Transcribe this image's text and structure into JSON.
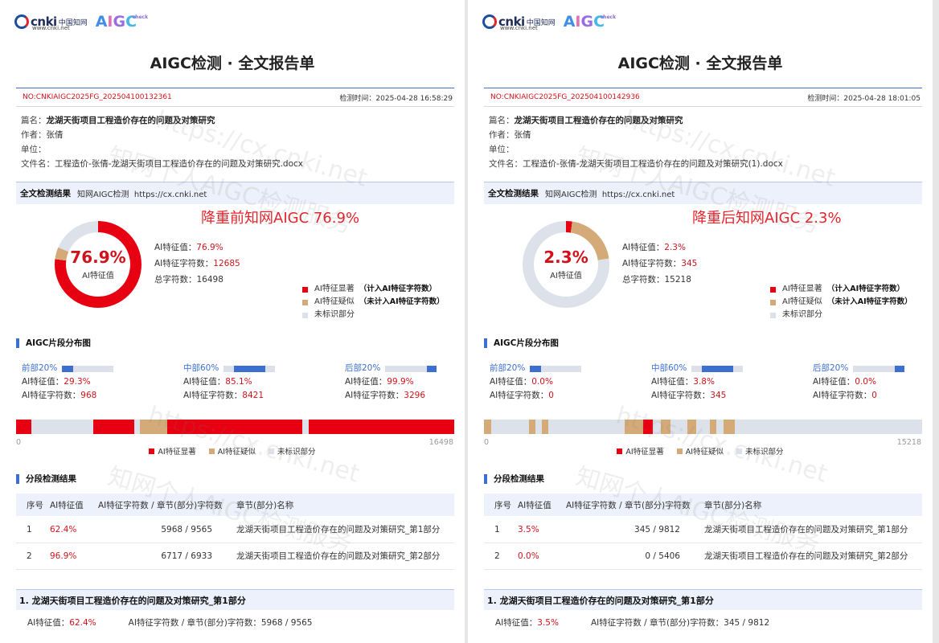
{
  "brand": {
    "cnki": "cnki",
    "cnki_cn": "中国知网",
    "cnki_url": "www.cnki.net",
    "aigc_letters": [
      "A",
      "I",
      "G",
      "C"
    ],
    "aigc_check": "check"
  },
  "report_title": "AIGC检测 · 全文报告单",
  "labels": {
    "detect_time": "检测时间：",
    "paper": "篇名：",
    "author": "作者：",
    "unit": "单位：",
    "filename": "文件名：",
    "fulltext_result": "全文检测结果",
    "service_name": "知网AIGC检测",
    "service_url": "https://cx.cnki.net",
    "ai_value": "AI特征值：",
    "ai_chars": "AI特征字符数：",
    "total_chars": "总字符数：",
    "donut_caption": "AI特征值",
    "legend": [
      {
        "name": "AI特征显著",
        "note": "（计入AI特征字符数）",
        "color": "#e60012"
      },
      {
        "name": "AI特征疑似",
        "note": "（未计入AI特征字符数）",
        "color": "#d4aa79"
      },
      {
        "name": "未标识部分",
        "note": "",
        "color": "#dde2ea"
      }
    ],
    "dist_title": "AIGC片段分布图",
    "seg_names": [
      "前部20%",
      "中部60%",
      "后部20%"
    ],
    "seg_ai_value": "AI特征值：",
    "seg_ai_chars": "AI特征字符数：",
    "dist_legend": [
      "AI特征显著",
      "AI特征疑似",
      "未标识部分"
    ],
    "sub_title": "分段检测结果",
    "table_head": [
      "序号",
      "AI特征值",
      "AI特征字符数 / 章节(部分)字符数",
      "章节(部分)名称"
    ],
    "part_foot_ai": "AI特征值：",
    "part_foot_cnt": "AI特征字符数 / 章节(部分)字符数："
  },
  "watermark": {
    "url": "https://cx.cnki.net",
    "service": "知网个人AIGC检测服务"
  },
  "reports": [
    {
      "report_no": "NO:CNKIAIGC2025FG_202504100132361",
      "detect_time": "2025-04-28 16:58:29",
      "paper_title": "龙湖天街项目工程造价存在的问题及对策研究",
      "author": "张倩",
      "unit": "",
      "filename": "工程造价-张倩-龙湖天街项目工程造价存在的问题及对策研究.docx",
      "headline": "降重前知网AIGC 76.9%",
      "ai_pct": "76.9%",
      "ai_pct_value": 76.9,
      "suspect_pct_value": 4.5,
      "ai_value": "76.9%",
      "ai_chars": "12685",
      "total_chars": "16498",
      "segments": [
        {
          "ai_value": "29.3%",
          "ai_chars": "968",
          "fill": 0.22
        },
        {
          "ai_value": "85.1%",
          "ai_chars": "8421",
          "fill": 0.6
        },
        {
          "ai_value": "99.9%",
          "ai_chars": "3296",
          "fill": 0.2
        }
      ],
      "dist_blocks": [
        {
          "start": 0.0,
          "end": 0.035,
          "type": "significant"
        },
        {
          "start": 0.176,
          "end": 0.27,
          "type": "significant"
        },
        {
          "start": 0.282,
          "end": 0.345,
          "type": "suspect"
        },
        {
          "start": 0.345,
          "end": 0.654,
          "type": "significant"
        },
        {
          "start": 0.668,
          "end": 1.0,
          "type": "significant"
        }
      ],
      "axis_start": "0",
      "axis_end": "16498",
      "rows": [
        {
          "no": "1",
          "ai": "62.4%",
          "cnt": "5968 / 9565",
          "name": "龙湖天街项目工程造价存在的问题及对策研究_第1部分"
        },
        {
          "no": "2",
          "ai": "96.9%",
          "cnt": "6717 / 6933",
          "name": "龙湖天街项目工程造价存在的问题及对策研究_第2部分"
        }
      ],
      "part_title": "1. 龙湖天街项目工程造价存在的问题及对策研究_第1部分",
      "part_ai": "62.4%",
      "part_cnt": "5968 / 9565"
    },
    {
      "report_no": "NO:CNKIAIGC2025FG_202504100142936",
      "detect_time": "2025-04-28 18:01:05",
      "paper_title": "龙湖天街项目工程造价存在的问题及对策研究",
      "author": "张倩",
      "unit": "",
      "filename": "工程造价-张倩-龙湖天街项目工程造价存在的问题及对策研究(1).docx",
      "headline": "降重后知网AIGC 2.3%",
      "ai_pct": "2.3%",
      "ai_pct_value": 2.3,
      "suspect_pct_value": 20.5,
      "ai_value": "2.3%",
      "ai_chars": "345",
      "total_chars": "15218",
      "segments": [
        {
          "ai_value": "0.0%",
          "ai_chars": "0",
          "fill": 0.22
        },
        {
          "ai_value": "3.8%",
          "ai_chars": "345",
          "fill": 0.6
        },
        {
          "ai_value": "0.0%",
          "ai_chars": "0",
          "fill": 0.2
        }
      ],
      "dist_blocks": [
        {
          "start": 0.0,
          "end": 0.017,
          "type": "suspect"
        },
        {
          "start": 0.103,
          "end": 0.117,
          "type": "suspect"
        },
        {
          "start": 0.132,
          "end": 0.146,
          "type": "suspect"
        },
        {
          "start": 0.322,
          "end": 0.363,
          "type": "suspect"
        },
        {
          "start": 0.363,
          "end": 0.386,
          "type": "significant"
        },
        {
          "start": 0.404,
          "end": 0.425,
          "type": "suspect"
        },
        {
          "start": 0.465,
          "end": 0.485,
          "type": "suspect"
        },
        {
          "start": 0.515,
          "end": 0.53,
          "type": "suspect"
        },
        {
          "start": 0.546,
          "end": 0.573,
          "type": "suspect"
        }
      ],
      "axis_start": "0",
      "axis_end": "15218",
      "rows": [
        {
          "no": "1",
          "ai": "3.5%",
          "cnt": "345 / 9812",
          "name": "龙湖天街项目工程造价存在的问题及对策研究_第1部分"
        },
        {
          "no": "2",
          "ai": "0.0%",
          "cnt": "0 / 5406",
          "name": "龙湖天街项目工程造价存在的问题及对策研究_第2部分"
        }
      ],
      "part_title": "1. 龙湖天街项目工程造价存在的问题及对策研究_第1部分",
      "part_ai": "3.5%",
      "part_cnt": "345 / 9812"
    }
  ]
}
